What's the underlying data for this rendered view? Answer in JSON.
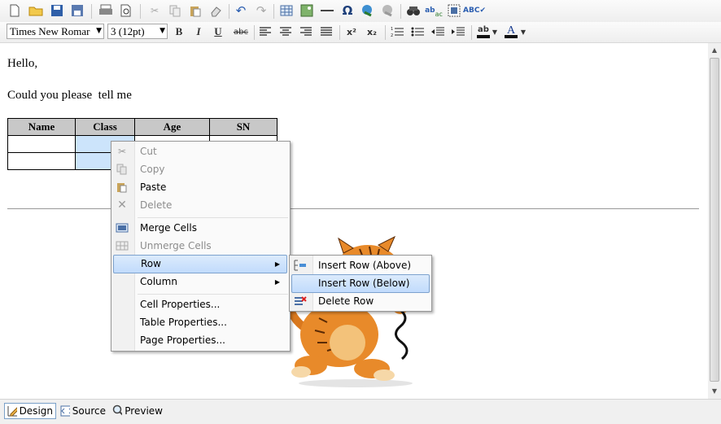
{
  "toolbar": {
    "font_family": "Times New Romar",
    "font_size": "3 (12pt)",
    "bold": "B",
    "italic": "I",
    "underline": "U",
    "strike": "abc",
    "superscript": "x²",
    "subscript": "x₂"
  },
  "document": {
    "greeting": "Hello,",
    "sentence": "Could you please  tell me",
    "table": {
      "headers": [
        "Name",
        "Class",
        "Age",
        "SN"
      ]
    }
  },
  "context_menu": {
    "cut": "Cut",
    "copy": "Copy",
    "paste": "Paste",
    "delete": "Delete",
    "merge_cells": "Merge Cells",
    "unmerge_cells": "Unmerge Cells",
    "row": "Row",
    "column": "Column",
    "cell_properties": "Cell Properties...",
    "table_properties": "Table Properties...",
    "page_properties": "Page Properties..."
  },
  "row_submenu": {
    "insert_above": "Insert Row (Above)",
    "insert_below": "Insert Row (Below)",
    "delete_row": "Delete Row"
  },
  "statusbar": {
    "design": "Design",
    "source": "Source",
    "preview": "Preview"
  },
  "colors": {
    "highlight": "#c1dbfc",
    "selected_cell": "#cce4fb",
    "header_cell": "#c8c8c8"
  }
}
